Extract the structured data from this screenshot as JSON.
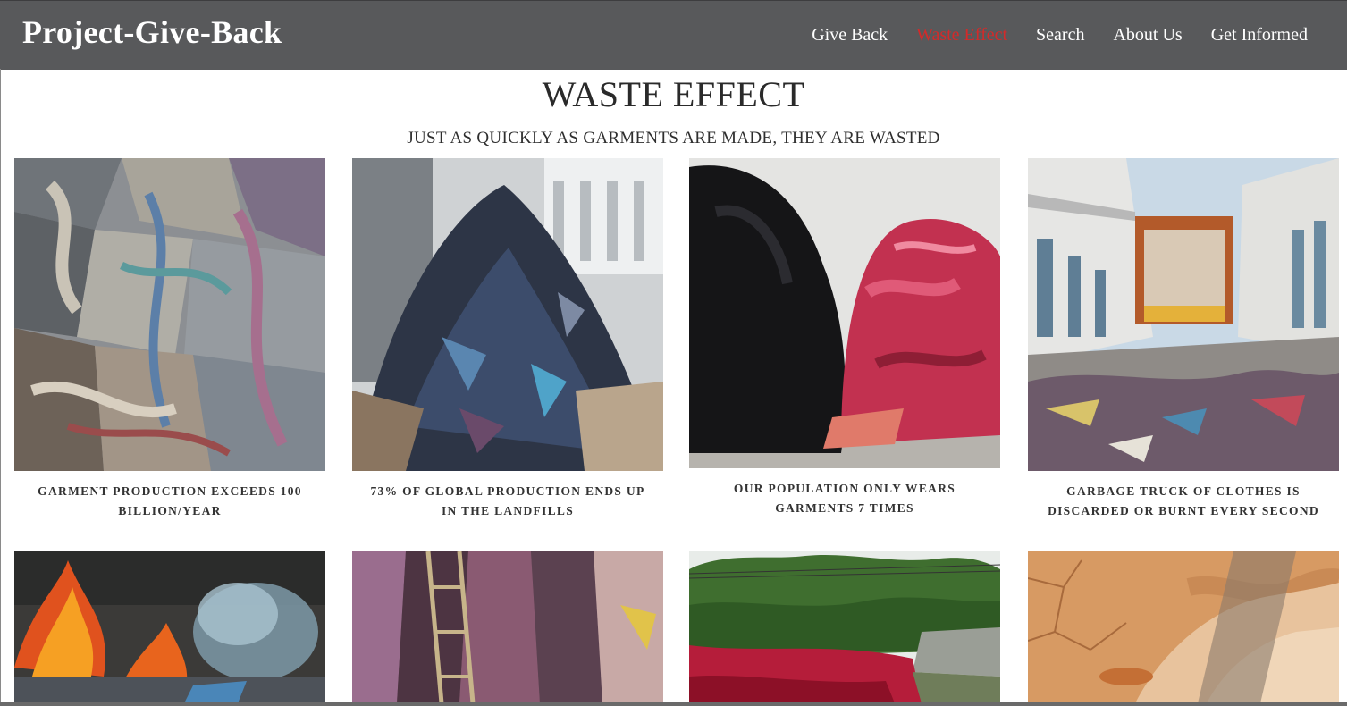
{
  "header": {
    "brand": "Project-Give-Back",
    "nav": [
      {
        "label": "Give Back",
        "active": false
      },
      {
        "label": "Waste Effect",
        "active": true
      },
      {
        "label": "Search",
        "active": false
      },
      {
        "label": "About Us",
        "active": false
      },
      {
        "label": "Get Informed",
        "active": false
      }
    ],
    "active_color": "#d32a2a",
    "bar_color": "#58595b"
  },
  "main": {
    "title": "WASTE EFFECT",
    "subtitle": "JUST AS QUICKLY AS GARMENTS ARE MADE, THEY ARE WASTED",
    "cards": [
      {
        "image": "clothes-pile-photo",
        "caption": "GARMENT PRODUCTION EXCEEDS 100 BILLION/YEAR"
      },
      {
        "image": "landfill-heap-photo",
        "caption": "73% OF GLOBAL PRODUCTION ENDS UP IN THE LANDFILLS"
      },
      {
        "image": "black-red-piles-photo",
        "caption": "OUR POPULATION ONLY WEARS GARMENTS 7 TIMES"
      },
      {
        "image": "garbage-truck-photo",
        "caption": "GARBAGE TRUCK OF CLOTHES IS DISCARDED OR BURNT EVERY SECOND"
      },
      {
        "image": "burning-clothes-photo",
        "caption": ""
      },
      {
        "image": "hanging-clothes-photo",
        "caption": ""
      },
      {
        "image": "polluted-river-photo",
        "caption": ""
      },
      {
        "image": "dry-cracked-earth-photo",
        "caption": ""
      }
    ]
  }
}
